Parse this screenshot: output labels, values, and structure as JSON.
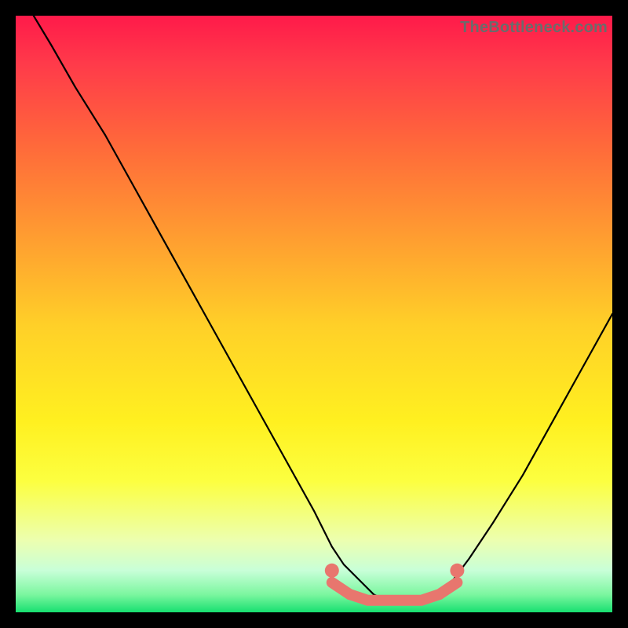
{
  "watermark": "TheBottleneck.com",
  "colors": {
    "frame": "#000000",
    "curve": "#000000",
    "markers": "#e8766e",
    "gradient_top": "#ff1a4a",
    "gradient_bottom": "#18e070"
  },
  "chart_data": {
    "type": "line",
    "title": "",
    "xlabel": "",
    "ylabel": "",
    "xlim": [
      0,
      100
    ],
    "ylim": [
      0,
      100
    ],
    "grid": false,
    "legend": false,
    "annotations": [
      "TheBottleneck.com"
    ],
    "series": [
      {
        "name": "bottleneck-curve",
        "x": [
          3,
          6,
          10,
          15,
          20,
          25,
          30,
          35,
          40,
          45,
          50,
          53,
          55,
          58,
          60,
          62,
          65,
          68,
          70,
          73,
          76,
          80,
          85,
          90,
          95,
          100
        ],
        "y": [
          100,
          95,
          88,
          80,
          71,
          62,
          53,
          44,
          35,
          26,
          17,
          11,
          8,
          5,
          3,
          2,
          2,
          2,
          3,
          5,
          9,
          15,
          23,
          32,
          41,
          50
        ]
      }
    ],
    "markers": {
      "name": "highlight-region",
      "x": [
        53,
        56,
        59,
        62,
        65,
        68,
        71,
        74
      ],
      "y": [
        5,
        3,
        2,
        2,
        2,
        2,
        3,
        5
      ]
    }
  }
}
